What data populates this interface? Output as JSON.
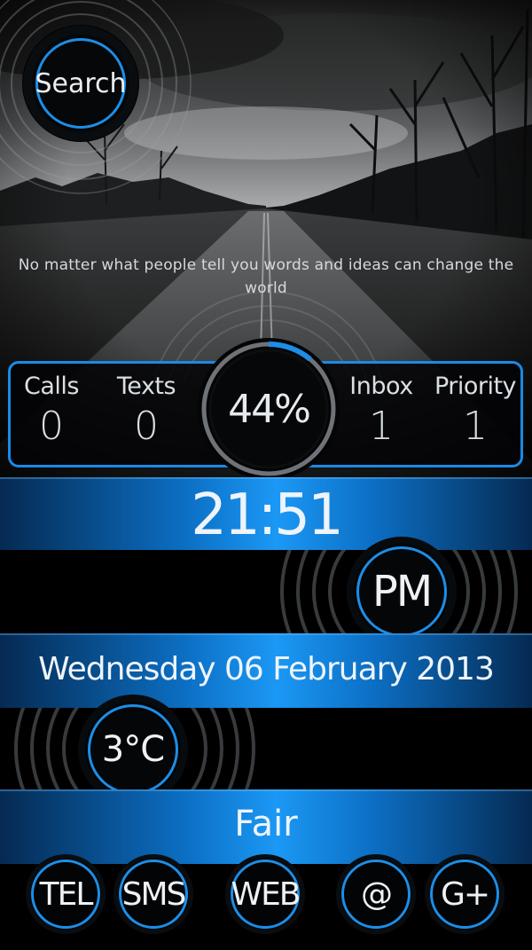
{
  "search": {
    "label": "Search"
  },
  "quote": {
    "text": "No matter what people tell you words and ideas can change the world"
  },
  "stats": {
    "calls": {
      "label": "Calls",
      "value": "0"
    },
    "texts": {
      "label": "Texts",
      "value": "0"
    },
    "inbox": {
      "label": "Inbox",
      "value": "1"
    },
    "priority": {
      "label": "Priority",
      "value": "1"
    }
  },
  "battery": {
    "label": "44%",
    "level": 0.44
  },
  "clock": {
    "time": "21:51",
    "ampm": "PM"
  },
  "date": {
    "text": "Wednesday 06 February 2013"
  },
  "weather": {
    "temperature": "3°C",
    "condition": "Fair"
  },
  "dock": [
    {
      "label": "TEL"
    },
    {
      "label": "SMS"
    },
    {
      "label": "WEB"
    },
    {
      "label": "@"
    },
    {
      "label": "G+"
    }
  ],
  "colors": {
    "accent": "#1c8ee8",
    "band": "#1b98f5",
    "background": "#000000"
  }
}
